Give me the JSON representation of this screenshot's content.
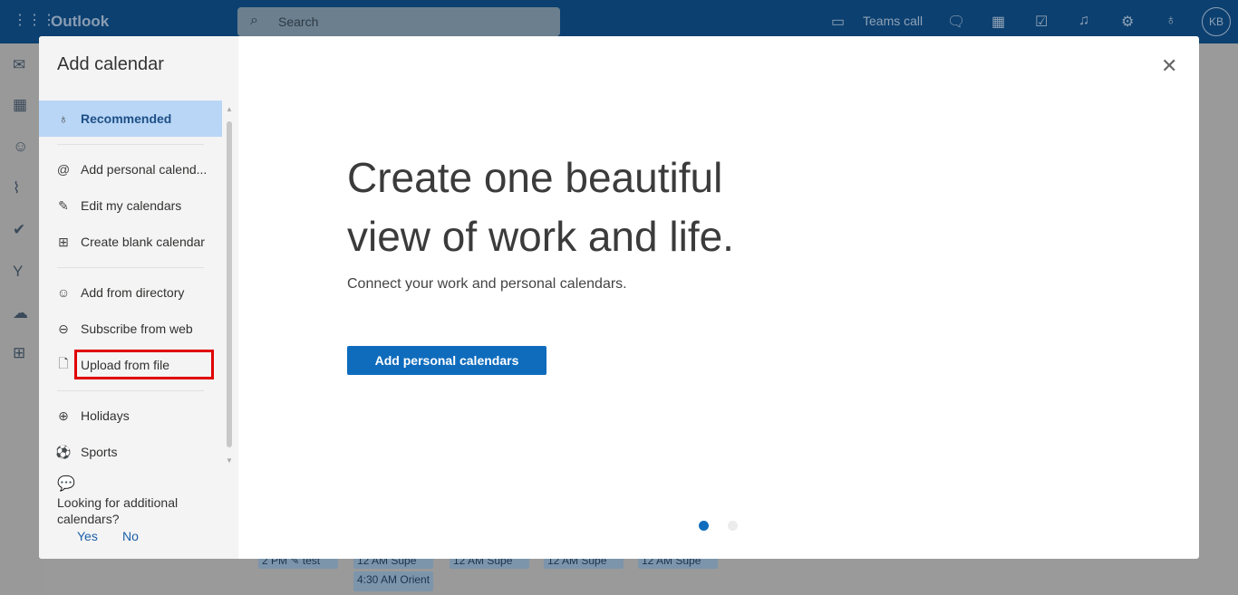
{
  "header": {
    "app_name": "Outlook",
    "search_placeholder": "Search",
    "teams_call": "Teams call",
    "avatar_initials": "KB"
  },
  "calendar_chips": [
    "2 PM ✎ test",
    "12 AM Supe",
    "4:30 AM Orient",
    "12 AM Supe",
    "12 AM Supe",
    "12 AM Supe"
  ],
  "modal": {
    "title": "Add calendar",
    "nav": [
      {
        "label": "Recommended",
        "icon": "lightbulb-icon",
        "selected": true
      },
      {
        "label": "Add personal calend...",
        "icon": "at-icon"
      },
      {
        "label": "Edit my calendars",
        "icon": "edit-icon"
      },
      {
        "label": "Create blank calendar",
        "icon": "calendar-add-icon"
      },
      {
        "label": "Add from directory",
        "icon": "people-icon"
      },
      {
        "label": "Subscribe from web",
        "icon": "link-icon"
      },
      {
        "label": "Upload from file",
        "icon": "file-icon",
        "highlighted": true
      },
      {
        "label": "Holidays",
        "icon": "globe-icon"
      },
      {
        "label": "Sports",
        "icon": "sports-icon"
      }
    ],
    "feedback": {
      "question": "Looking for additional calendars?",
      "yes": "Yes",
      "no": "No"
    },
    "hero_line1": "Create one beautiful",
    "hero_line2": "view of work and life.",
    "subtitle": "Connect your work and personal calendars.",
    "cta": "Add personal calendars",
    "carousel": {
      "current": 1,
      "total": 2
    }
  },
  "colors": {
    "accent": "#0f6cbd",
    "selected": "#b9d6f6",
    "highlight_box": "#e00000",
    "topbar": "#0c4070"
  }
}
